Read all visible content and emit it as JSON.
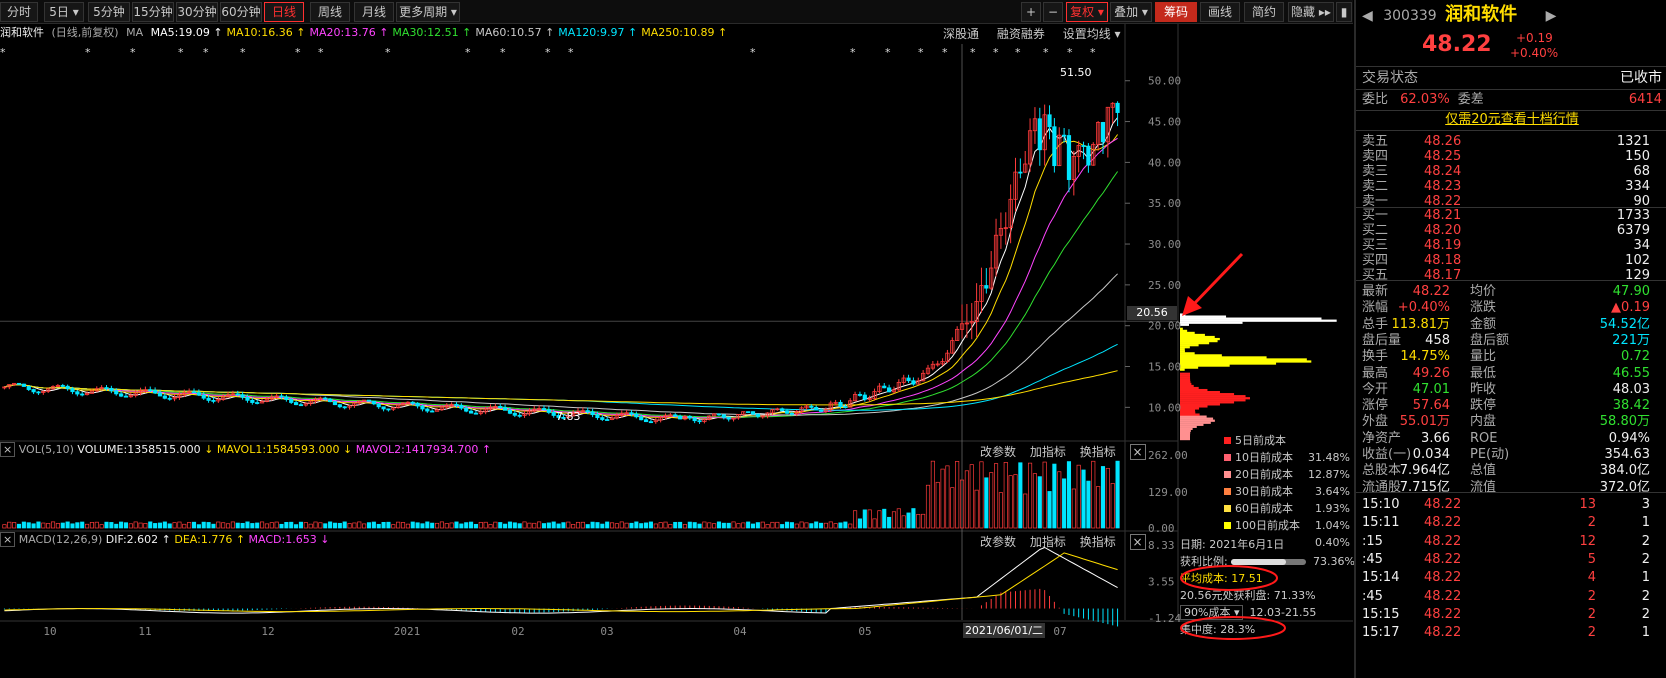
{
  "toolbar": {
    "periods": [
      "分时",
      "5日",
      "5分钟",
      "15分钟",
      "30分钟",
      "60分钟",
      "日线",
      "周线",
      "月线",
      "更多周期"
    ],
    "active_period": "日线",
    "right_buttons": [
      "+",
      "−",
      "复权",
      "叠加",
      "筹码",
      "画线",
      "简约",
      "隐藏"
    ]
  },
  "legend": {
    "name": "润和软件",
    "mode": "(日线,前复权)",
    "ma_label": "MA",
    "ma": [
      {
        "label": "MA5:19.09",
        "color": "#ffffff"
      },
      {
        "label": "MA10:16.36",
        "color": "#ffdd00"
      },
      {
        "label": "MA20:13.76",
        "color": "#ff44ff"
      },
      {
        "label": "MA30:12.51",
        "color": "#30e030"
      },
      {
        "label": "MA60:10.57",
        "color": "#c8c8c8"
      },
      {
        "label": "MA120:9.97",
        "color": "#00e5ff"
      },
      {
        "label": "MA250:10.89",
        "color": "#ffdd00"
      }
    ],
    "links": [
      "深股通",
      "融资融券",
      "设置均线"
    ]
  },
  "price_axis": [
    "50.00",
    "45.00",
    "40.00",
    "35.00",
    "30.00",
    "25.00",
    "20.00",
    "15.00",
    "10.00"
  ],
  "price_marker": "20.56",
  "high_label": "51.50",
  "low_label": "7.83",
  "vol_panel": {
    "header": [
      "VOL(5,10)",
      "VOLUME:1358515.000",
      "MAVOL1:1584593.000",
      "MAVOL2:1417934.700"
    ],
    "axis": [
      "262.00",
      "129.00",
      "0.00"
    ],
    "actions": [
      "改参数",
      "加指标",
      "换指标"
    ]
  },
  "macd_panel": {
    "header": [
      "MACD(12,26,9)",
      "DIF:2.602",
      "DEA:1.776",
      "MACD:1.653"
    ],
    "axis": [
      "8.33",
      "3.55",
      "-1.24"
    ],
    "actions": [
      "改参数",
      "加指标",
      "换指标"
    ]
  },
  "date_axis": [
    "10",
    "11",
    "12",
    "2021",
    "02",
    "03",
    "04",
    "05",
    "07"
  ],
  "date_cursor": "2021/06/01/二",
  "cost_legend": [
    {
      "label": "5日前成本",
      "value": "31.48%",
      "color": "#ff2020"
    },
    {
      "label": "10日前成本",
      "value": "12.87%",
      "color": "#ff6070"
    },
    {
      "label": "20日前成本",
      "value": "3.64%",
      "color": "#ff9090"
    },
    {
      "label": "30日前成本",
      "value": "1.93%",
      "color": "#ff8040"
    },
    {
      "label": "60日前成本",
      "value": "1.04%",
      "color": "#ffe040"
    },
    {
      "label": "100日前成本",
      "value": "0.40%",
      "color": "#ffff00"
    }
  ],
  "cost_info": {
    "date": "日期: 2021年6月1日",
    "profit_label": "获利比例:",
    "profit_value": "73.36%",
    "avg_cost": "平均成本: 17.51",
    "profit_at": "20.56元处获利盘: 71.33%",
    "range_select": "90%成本",
    "range": "12.03-21.55",
    "concentration": "集中度: 28.3%"
  },
  "quote": {
    "code": "300339",
    "name": "润和软件",
    "price": "48.22",
    "change": "+0.19",
    "change_pct": "+0.40%",
    "status_label": "交易状态",
    "status": "已收市",
    "weibi_label": "委比",
    "weibi": "62.03%",
    "weicha_label": "委差",
    "weicha": "6414",
    "promo": "仅需20元查看十档行情",
    "sells": [
      {
        "label": "卖五",
        "price": "48.26",
        "vol": "1321"
      },
      {
        "label": "卖四",
        "price": "48.25",
        "vol": "150"
      },
      {
        "label": "卖三",
        "price": "48.24",
        "vol": "68"
      },
      {
        "label": "卖二",
        "price": "48.23",
        "vol": "334"
      },
      {
        "label": "卖一",
        "price": "48.22",
        "vol": "90"
      }
    ],
    "buys": [
      {
        "label": "买一",
        "price": "48.21",
        "vol": "1733"
      },
      {
        "label": "买二",
        "price": "48.20",
        "vol": "6379"
      },
      {
        "label": "买三",
        "price": "48.19",
        "vol": "34"
      },
      {
        "label": "买四",
        "price": "48.18",
        "vol": "102"
      },
      {
        "label": "买五",
        "price": "48.17",
        "vol": "129"
      }
    ],
    "stats": [
      [
        "最新",
        "48.22",
        "red",
        "均价",
        "47.90",
        "grn"
      ],
      [
        "涨幅",
        "+0.40%",
        "red",
        "涨跌",
        "▲0.19",
        "red"
      ],
      [
        "总手",
        "113.81万",
        "yel",
        "金额",
        "54.52亿",
        "cy"
      ],
      [
        "盘后量",
        "458",
        "wht",
        "盘后额",
        "221万",
        "cy"
      ],
      [
        "换手",
        "14.75%",
        "yel",
        "量比",
        "0.72",
        "grn"
      ],
      [
        "最高",
        "49.26",
        "red",
        "最低",
        "46.55",
        "grn"
      ],
      [
        "今开",
        "47.01",
        "grn",
        "昨收",
        "48.03",
        "wht"
      ],
      [
        "涨停",
        "57.64",
        "red",
        "跌停",
        "38.42",
        "grn"
      ],
      [
        "外盘",
        "55.01万",
        "red",
        "内盘",
        "58.80万",
        "grn"
      ],
      [
        "净资产",
        "3.66",
        "wht",
        "ROE",
        "0.94%",
        "wht"
      ],
      [
        "收益(一)",
        "0.034",
        "wht",
        "PE(动)",
        "354.63",
        "wht"
      ],
      [
        "总股本",
        "7.964亿",
        "wht",
        "总值",
        "384.0亿",
        "wht"
      ],
      [
        "流通股",
        "7.715亿",
        "wht",
        "流值",
        "372.0亿",
        "wht"
      ]
    ],
    "ticks": [
      [
        "15:10",
        "48.22",
        "13",
        "3"
      ],
      [
        "15:11",
        "48.22",
        "2",
        "1"
      ],
      [
        ":15",
        "48.22",
        "12",
        "2"
      ],
      [
        ":45",
        "48.22",
        "5",
        "2"
      ],
      [
        "15:14",
        "48.22",
        "4",
        "1"
      ],
      [
        ":45",
        "48.22",
        "2",
        "2"
      ],
      [
        "15:15",
        "48.22",
        "2",
        "2"
      ],
      [
        "15:17",
        "48.22",
        "2",
        "1"
      ]
    ]
  }
}
